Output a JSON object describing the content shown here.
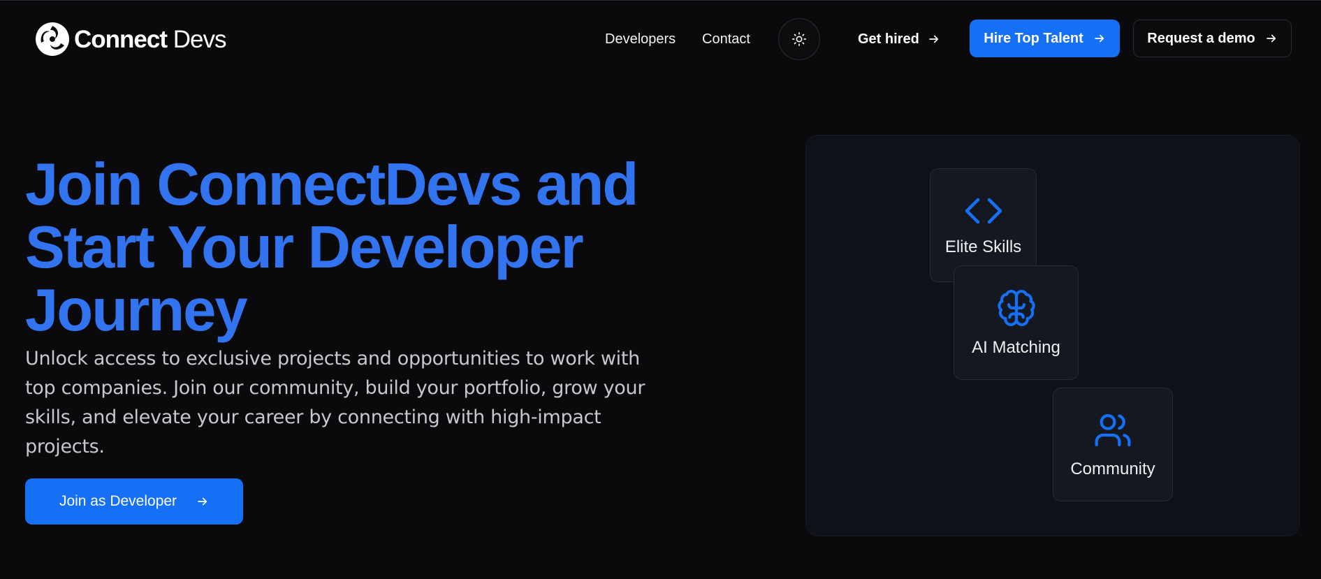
{
  "brand": {
    "name_strong": "Connect",
    "name_light": " Devs",
    "accent_color": "#1670f5",
    "title_color": "#3273f0"
  },
  "nav": {
    "links": [
      {
        "label": "Developers"
      },
      {
        "label": "Contact"
      }
    ],
    "theme_toggle_icon": "sun-icon",
    "get_hired_label": "Get hired",
    "hire_label": "Hire Top Talent",
    "demo_label": "Request a demo"
  },
  "hero": {
    "title_lines": [
      "Join ConnectDevs and",
      "Start Your Developer",
      "Journey"
    ],
    "description": "Unlock access to exclusive projects and opportunities to work with top companies. Join our community, build your portfolio, grow your skills, and elevate your career by connecting with high-impact projects.",
    "cta_label": "Join as Developer"
  },
  "features": [
    {
      "label": "Elite Skills",
      "icon": "code-icon"
    },
    {
      "label": "AI Matching",
      "icon": "brain-icon"
    },
    {
      "label": "Community",
      "icon": "users-icon"
    }
  ]
}
